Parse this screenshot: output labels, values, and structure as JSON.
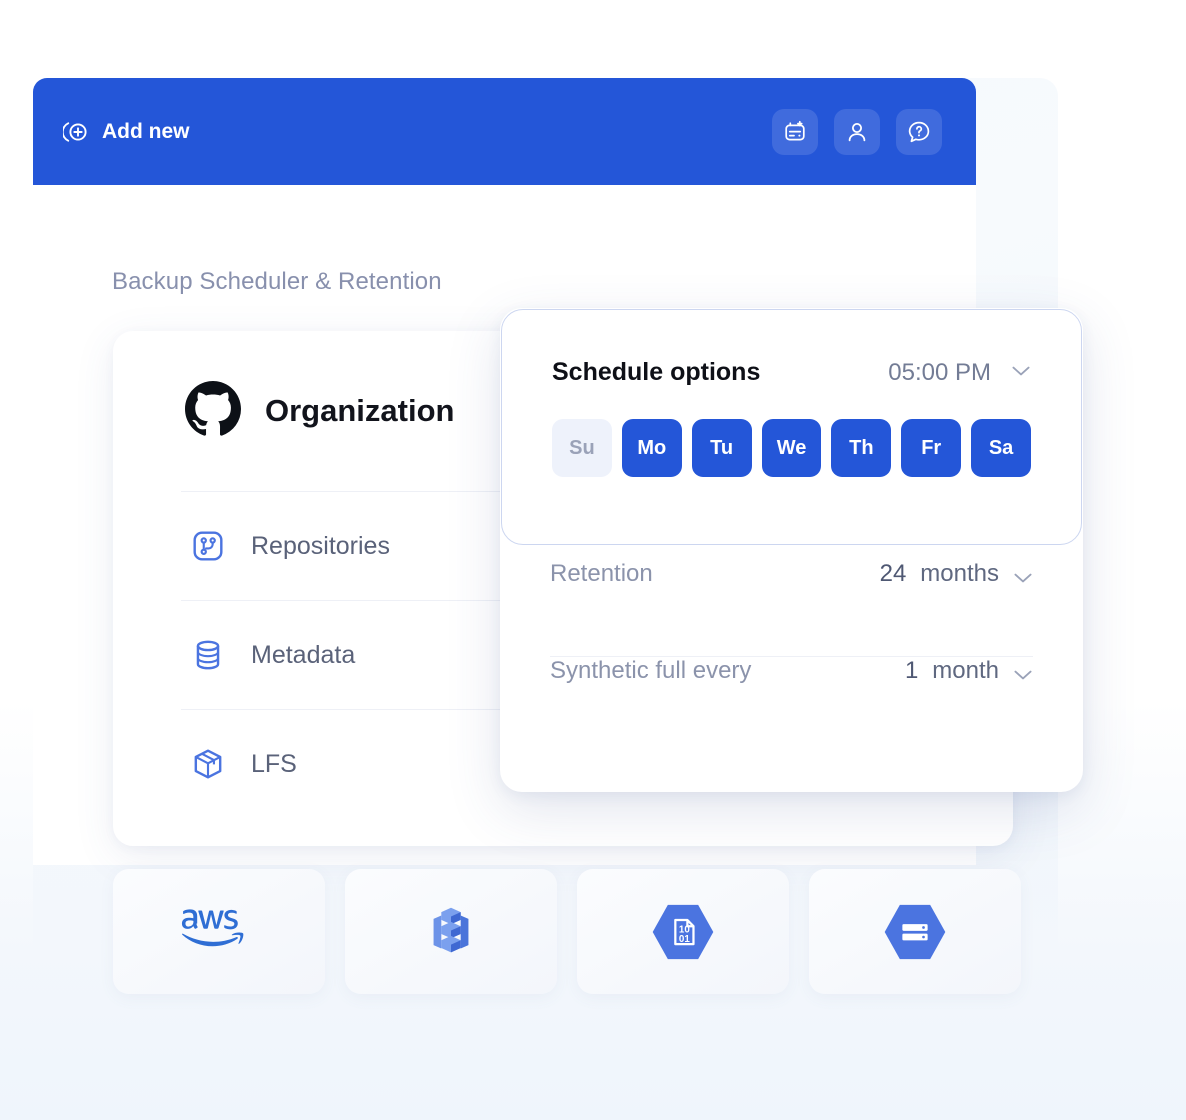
{
  "topbar": {
    "add_new_label": "Add new",
    "add_new_icon": "circle-plus-icon",
    "actions": [
      {
        "icon": "calendar-add-icon",
        "name": "calendar-add-button"
      },
      {
        "icon": "user-icon",
        "name": "account-button"
      },
      {
        "icon": "help-question-icon",
        "name": "help-button"
      }
    ],
    "background_color": "#2456d8"
  },
  "page": {
    "section_title": "Backup Scheduler & Retention",
    "background_color": "#f4f8fd"
  },
  "org_card": {
    "logo_icon": "github-octocat-icon",
    "title": "Organization",
    "rows": [
      {
        "icon": "repository-icon",
        "label": "Repositories"
      },
      {
        "icon": "database-icon",
        "label": "Metadata"
      },
      {
        "icon": "package-box-icon",
        "label": "LFS"
      }
    ]
  },
  "schedule_panel": {
    "title": "Schedule options",
    "time_value": "05:00 PM",
    "time_chevron_icon": "chevron-down-icon",
    "days": [
      {
        "label": "Su",
        "selected": false
      },
      {
        "label": "Mo",
        "selected": true
      },
      {
        "label": "Tu",
        "selected": true
      },
      {
        "label": "We",
        "selected": true
      },
      {
        "label": "Th",
        "selected": true
      },
      {
        "label": "Fr",
        "selected": true
      },
      {
        "label": "Sa",
        "selected": true
      }
    ],
    "active_color": "#2456d8",
    "inactive_color": "#eef2fb",
    "border_color": "#ccd6f0"
  },
  "fields": {
    "retention": {
      "label": "Retention",
      "number": "24",
      "unit": "months",
      "chevron_icon": "chevron-down-icon"
    },
    "synthetic_full": {
      "label": "Synthetic full every",
      "number": "1",
      "unit": "month",
      "chevron_icon": "chevron-down-icon"
    }
  },
  "storage_tiles": [
    {
      "icon": "aws-logo-icon",
      "name": "aws"
    },
    {
      "icon": "aws-s3-bucket-icon",
      "name": "aws-s3"
    },
    {
      "icon": "azure-blob-storage-icon",
      "name": "azure-blob-storage"
    },
    {
      "icon": "google-cloud-storage-icon",
      "name": "google-cloud-storage"
    }
  ]
}
